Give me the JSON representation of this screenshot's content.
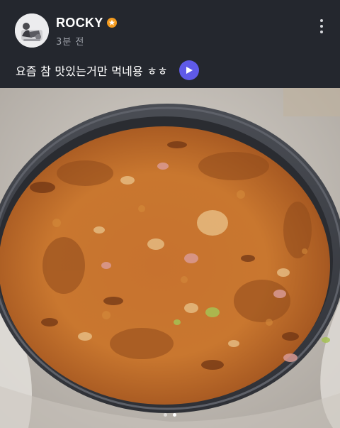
{
  "post": {
    "username": "ROCKY",
    "badge_icon": "verified-badge-icon",
    "badge_color": "#f39a1e",
    "timestamp": "3분 전",
    "caption": "요즘 참 맛있는거만 먹네용 ㅎㅎ",
    "play_icon": "play-icon",
    "play_color": "#5f5ae8",
    "more_icon": "more-vertical-icon",
    "image": {
      "subject": "kimchi seafood pancake in a dark oval pan",
      "page_count": 2,
      "current_page": 2
    }
  }
}
